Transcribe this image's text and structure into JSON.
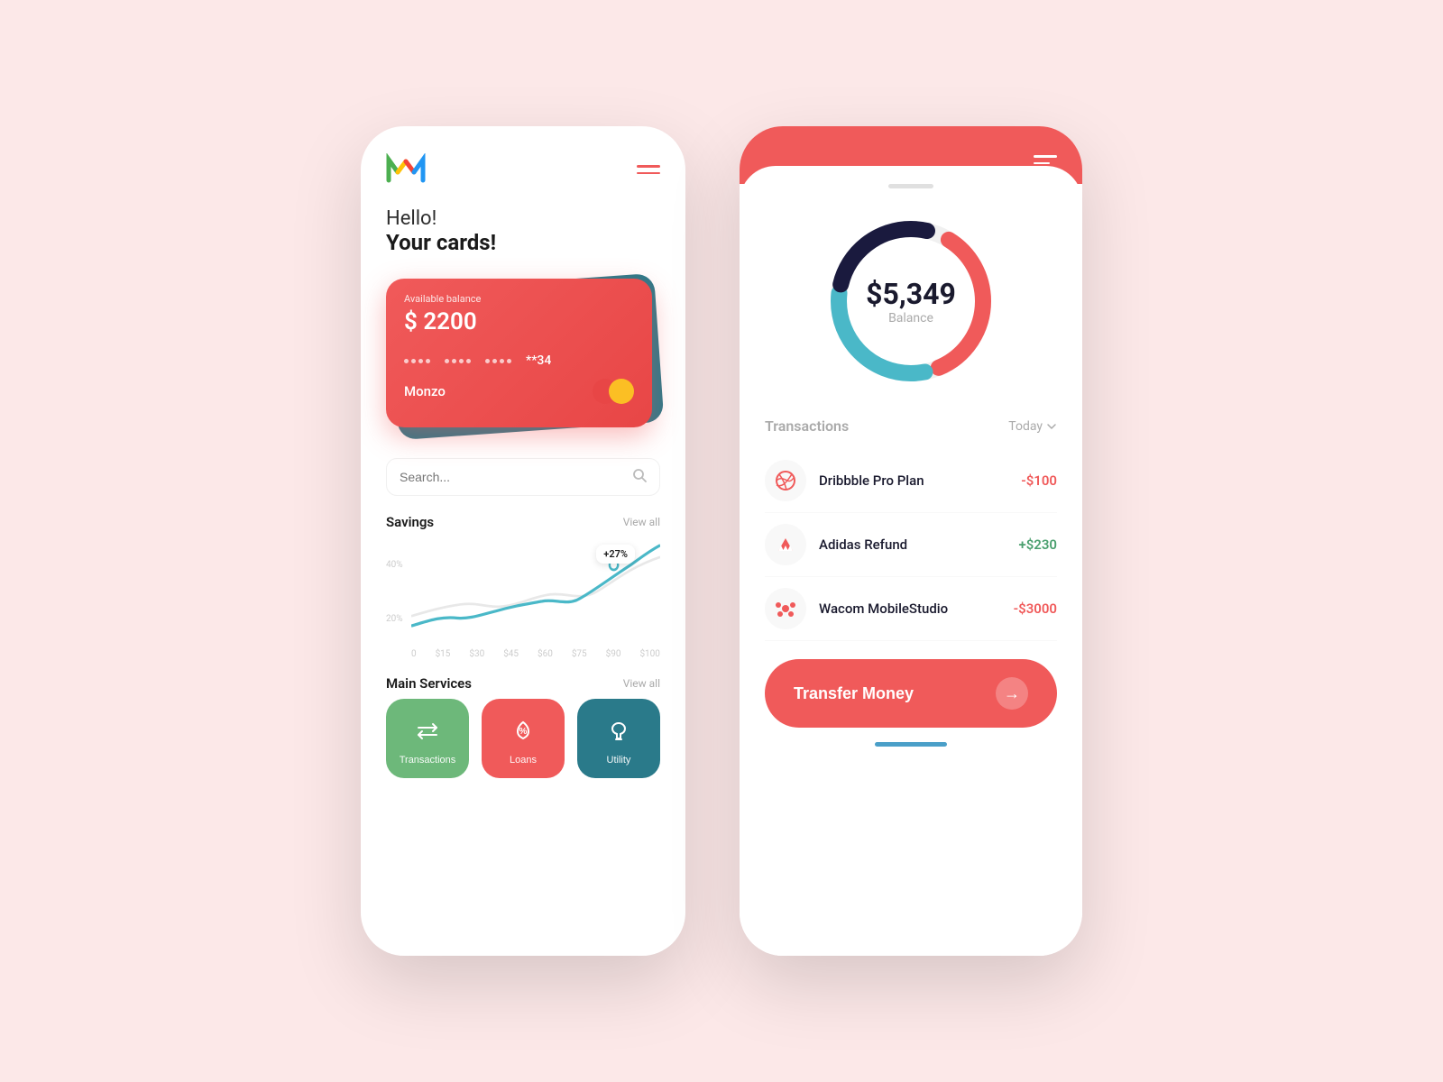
{
  "app": {
    "background_color": "#fce8e8"
  },
  "left_phone": {
    "greeting_hello": "Hello!",
    "greeting_cards": "Your cards!",
    "card": {
      "available_label": "Available balance",
      "balance": "$ 2200",
      "card_dots": "•••• •••• ••••",
      "last_digits": "**34",
      "card_name": "Monzo"
    },
    "search_placeholder": "Search...",
    "savings_section": {
      "title": "Savings",
      "view_all": "View all",
      "tooltip": "+27%",
      "y_labels": [
        "40%",
        "20%"
      ],
      "x_labels": [
        "0",
        "$15",
        "$30",
        "$45",
        "$60",
        "$75",
        "$90",
        "$100"
      ]
    },
    "services_section": {
      "title": "Main Services",
      "view_all": "View all",
      "services": [
        {
          "label": "Transactions",
          "color": "green"
        },
        {
          "label": "Loans",
          "color": "red"
        },
        {
          "label": "Utility",
          "color": "teal"
        }
      ]
    }
  },
  "right_phone": {
    "balance_amount": "$5,349",
    "balance_label": "Balance",
    "transactions_title": "Transactions",
    "filter_label": "Today",
    "transactions": [
      {
        "name": "Dribbble Pro Plan",
        "amount": "-$100",
        "type": "negative"
      },
      {
        "name": "Adidas Refund",
        "amount": "+$230",
        "type": "positive"
      },
      {
        "name": "Wacom MobileStudio",
        "amount": "-$3000",
        "type": "negative"
      }
    ],
    "transfer_button": "Transfer Money",
    "donut": {
      "red_percent": 35,
      "teal_percent": 30,
      "dark_percent": 25,
      "gap_percent": 10
    }
  }
}
